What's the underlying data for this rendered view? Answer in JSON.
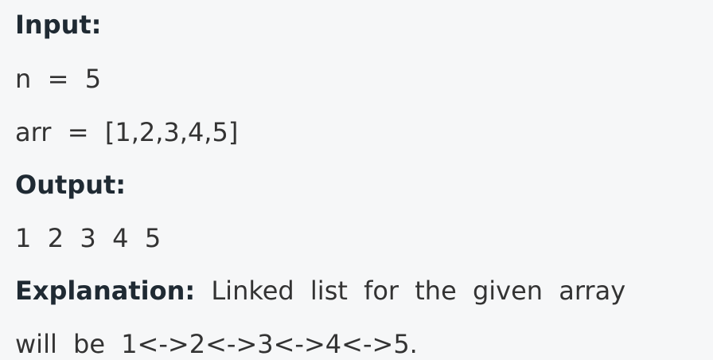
{
  "input_label": "Input:",
  "n_line": "n  =  5",
  "arr_line": "arr  =  [1,2,3,4,5]",
  "output_label": "Output:",
  "output_value": "1  2  3  4  5",
  "explanation_label": "Explanation:",
  "explanation_line1": " Linked list for the given array",
  "explanation_line2": "will be 1<->2<->3<->4<->5."
}
